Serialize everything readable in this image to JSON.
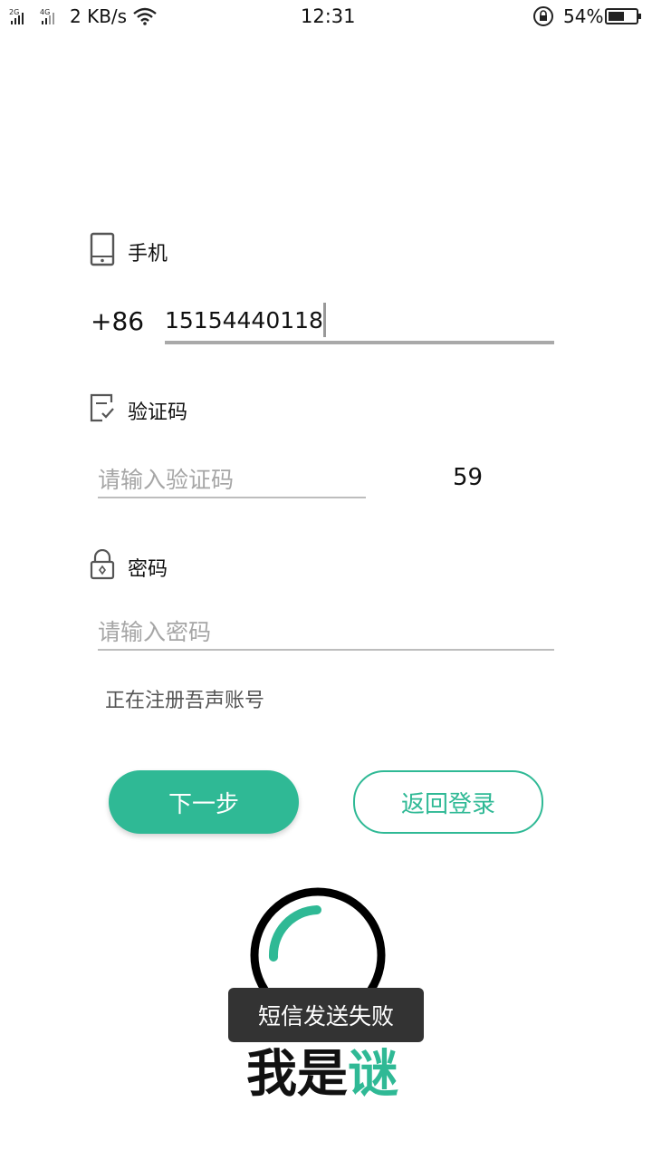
{
  "status_bar": {
    "network_1": "2G",
    "network_2": "4G",
    "speed": "2 KB/s",
    "time": "12:31",
    "battery": "54%"
  },
  "form": {
    "phone_label": "手机",
    "country_code": "+86",
    "phone_value": "15154440118",
    "code_label": "验证码",
    "code_placeholder": "请输入验证码",
    "countdown": "59",
    "password_label": "密码",
    "password_placeholder": "请输入密码",
    "register_status": "正在注册吾声账号"
  },
  "buttons": {
    "next": "下一步",
    "back_login": "返回登录"
  },
  "toast": "短信发送失败",
  "brand": {
    "part1": "我是",
    "part2": "谜"
  },
  "colors": {
    "accent": "#2fb995"
  }
}
